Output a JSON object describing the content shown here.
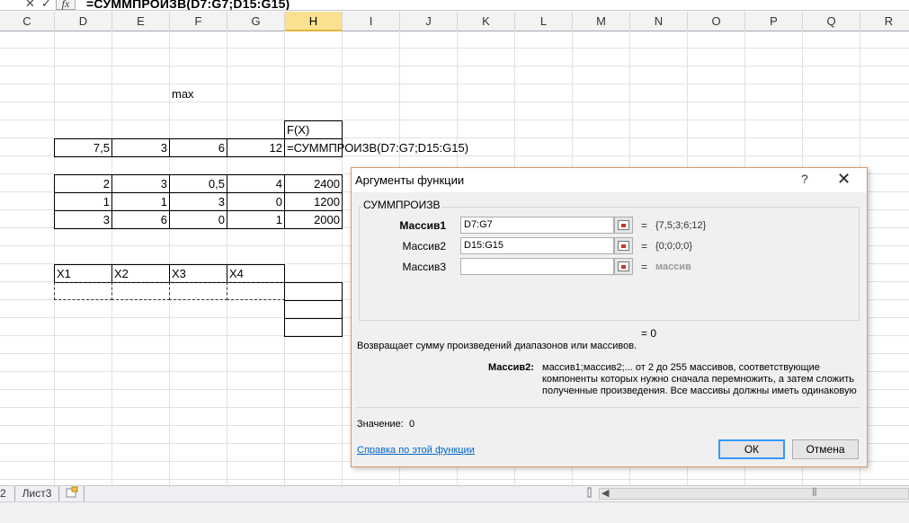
{
  "formula_bar": {
    "cancel": "✕",
    "enter": "✓",
    "fx": "fx",
    "formula": "=СУММПРОИЗВ(D7:G7;D15:G15)"
  },
  "columns": [
    "C",
    "D",
    "E",
    "F",
    "G",
    "H",
    "I",
    "J",
    "K",
    "L",
    "M",
    "N",
    "O",
    "P",
    "Q",
    "R"
  ],
  "selected_column": "H",
  "cells": {
    "max_label": "max",
    "fx_header": "F(X)",
    "row_d7": [
      "7,5",
      "3",
      "6",
      "12"
    ],
    "h7_formula": "=СУММПРОИЗВ(D7:G7;D15:G15)",
    "table_rows": [
      [
        "2",
        "3",
        "0,5",
        "4",
        "2400"
      ],
      [
        "1",
        "1",
        "3",
        "0",
        "1200"
      ],
      [
        "3",
        "6",
        "0",
        "1",
        "2000"
      ]
    ],
    "var_headers": [
      "X1",
      "X2",
      "X3",
      "X4"
    ]
  },
  "dialog": {
    "title": "Аргументы функции",
    "help_glyph": "?",
    "close_glyph": "✕",
    "function_name": "СУММПРОИЗВ",
    "args": [
      {
        "label": "Массив1",
        "value": "D7:G7",
        "result": "{7,5;3;6;12}"
      },
      {
        "label": "Массив2",
        "value": "D15:G15",
        "result": "{0;0;0;0}"
      },
      {
        "label": "Массив3",
        "value": "",
        "result": "массив"
      }
    ],
    "equals": "=",
    "result_line": "= 0",
    "description": "Возвращает сумму произведений диапазонов или массивов.",
    "param_label": "Массив2:",
    "param_description": "массив1;массив2;... от 2 до 255 массивов, соответствующие компоненты которых нужно сначала перемножить, а затем сложить полученные произведения. Все массивы должны иметь одинаковую",
    "value_label": "Значение:",
    "value": "0",
    "help_link": "Справка по этой функции",
    "ok": "ОК",
    "cancel": "Отмена"
  },
  "sheet_tabs": [
    "2",
    "Лист3"
  ]
}
